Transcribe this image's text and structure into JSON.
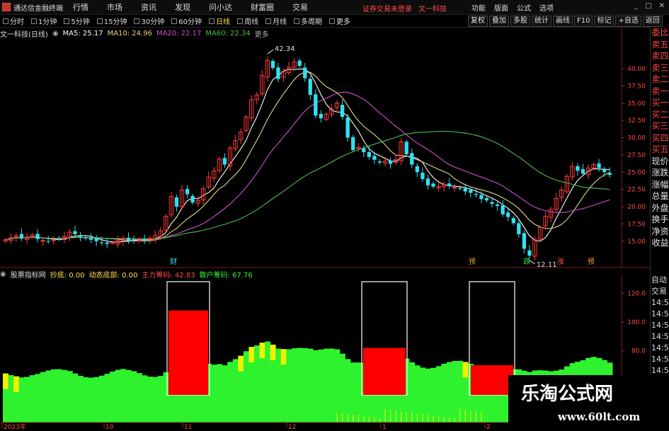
{
  "menubar": {
    "app_title": "通达信金融终端",
    "items": [
      "行情",
      "市场",
      "资讯",
      "发现",
      "问小达",
      "财富圈",
      "交易"
    ],
    "login_status": "证券交易未登录",
    "login_company": "文一科技",
    "right_items": [
      "功能",
      "版面",
      "公式",
      "选项"
    ],
    "window_buttons": [
      "_",
      "□",
      "✕"
    ]
  },
  "periodbar": {
    "periods": [
      "分时",
      "1分钟",
      "5分钟",
      "15分钟",
      "30分钟",
      "60分钟",
      "日线",
      "周线",
      "月线",
      "多周期",
      "更多"
    ],
    "active": "日线",
    "tools": [
      "复权",
      "叠加",
      "多股",
      "统计",
      "画线",
      "F10",
      "标记",
      "+自选",
      "返回"
    ]
  },
  "main_info": {
    "stock": "文一科技(日线)",
    "ma5": "MA5: 25.17",
    "ma10": "MA10: 24.96",
    "ma20": "MA20: 22.17",
    "ma60": "MA60: 22.34"
  },
  "sub_info": {
    "indicator": "股票指标网",
    "chaodi": "抄底: 0.00",
    "dongtai": "动态底部: 0.00",
    "zhuli": "主力筹码: 42.83",
    "sanhu": "散户筹码: 67.76"
  },
  "annotations": {
    "high": "42.34",
    "low": "12.11",
    "markers": [
      "财",
      "预",
      "跌",
      "涨",
      "预"
    ]
  },
  "right_panel_main": [
    "委比",
    "卖五",
    "卖四",
    "卖三",
    "卖二",
    "卖一",
    "买一",
    "买二",
    "买三",
    "买四",
    "买五",
    "现价",
    "涨跌",
    "涨幅",
    "总量",
    "外盘",
    "换手",
    "净资",
    "收益"
  ],
  "right_panel_sub": [
    "自动",
    "交易",
    "14:5",
    "14:5",
    "14:5",
    "14:5",
    "14:5",
    "14:5",
    "14:5",
    "14:5"
  ],
  "x_dates": [
    "2023年",
    "10",
    "11",
    "12",
    "1",
    "2"
  ],
  "watermark": {
    "title": "乐淘公式网",
    "url": "www.60lt.com"
  },
  "colors": {
    "up": "#ff3b3b",
    "down": "#33e0f0",
    "ma5": "#ffffff",
    "ma10": "#e8d48a",
    "ma20": "#d050d0",
    "ma60": "#48c048",
    "green_band": "#2ef22e",
    "yellow_band": "#f0f000"
  },
  "chart_data": [
    {
      "type": "candlestick",
      "title": "文一科技(日线)",
      "ylim": [
        12,
        44
      ],
      "yticks": [
        15.0,
        17.5,
        20.0,
        22.5,
        25.0,
        27.5,
        30.0,
        32.5,
        35.0,
        37.5,
        40.0
      ],
      "x_labels": [
        "2023年",
        "10",
        "11",
        "12",
        "1",
        "2"
      ],
      "close_path": [
        15.2,
        15.5,
        15.8,
        15.4,
        15.6,
        15.9,
        15.3,
        15.1,
        15.0,
        15.2,
        15.4,
        15.7,
        16.3,
        16.0,
        15.6,
        15.4,
        15.2,
        15.0,
        14.8,
        14.6,
        14.8,
        15.1,
        15.4,
        15.0,
        15.2,
        15.3,
        15.1,
        15.4,
        15.8,
        16.5,
        18.6,
        21.5,
        20.0,
        22.4,
        21.8,
        20.6,
        20.9,
        22.6,
        24.3,
        25.2,
        26.9,
        26.1,
        28.5,
        29.6,
        30.8,
        33.0,
        35.5,
        36.2,
        39.0,
        41.2,
        40.1,
        38.5,
        39.6,
        40.2,
        41.0,
        40.4,
        38.6,
        36.2,
        33.2,
        32.8,
        33.4,
        34.2,
        35.0,
        33.0,
        30.0,
        28.2,
        28.6,
        27.9,
        27.2,
        26.8,
        26.4,
        26.6,
        26.2,
        26.8,
        29.4,
        27.6,
        26.1,
        25.0,
        24.0,
        23.1,
        22.9,
        22.9,
        23.2,
        23.0,
        22.8,
        22.6,
        22.2,
        22.0,
        21.7,
        21.1,
        20.9,
        20.4,
        20.1,
        18.9,
        18.5,
        17.6,
        16.0,
        13.9,
        12.9,
        15.2,
        17.0,
        18.6,
        19.6,
        21.2,
        22.4,
        24.4,
        25.8,
        25.2,
        24.8,
        25.6,
        26.1,
        25.6,
        25.0,
        24.6
      ],
      "high": 42.34,
      "low": 12.11,
      "ma5": 25.17,
      "ma10": 24.96,
      "ma20": 22.17,
      "ma60": 22.34
    },
    {
      "type": "bar",
      "title": "股票指标网",
      "ylim": [
        40,
        125
      ],
      "yticks": [
        60.0,
        80.0,
        100.0,
        120.0
      ],
      "series": [
        {
          "name": "主力筹码",
          "values": [
            42.83
          ]
        },
        {
          "name": "散户筹码",
          "values": [
            67.76
          ]
        }
      ],
      "red_bars_top": [
        108.0,
        82.0,
        70.0
      ]
    }
  ]
}
